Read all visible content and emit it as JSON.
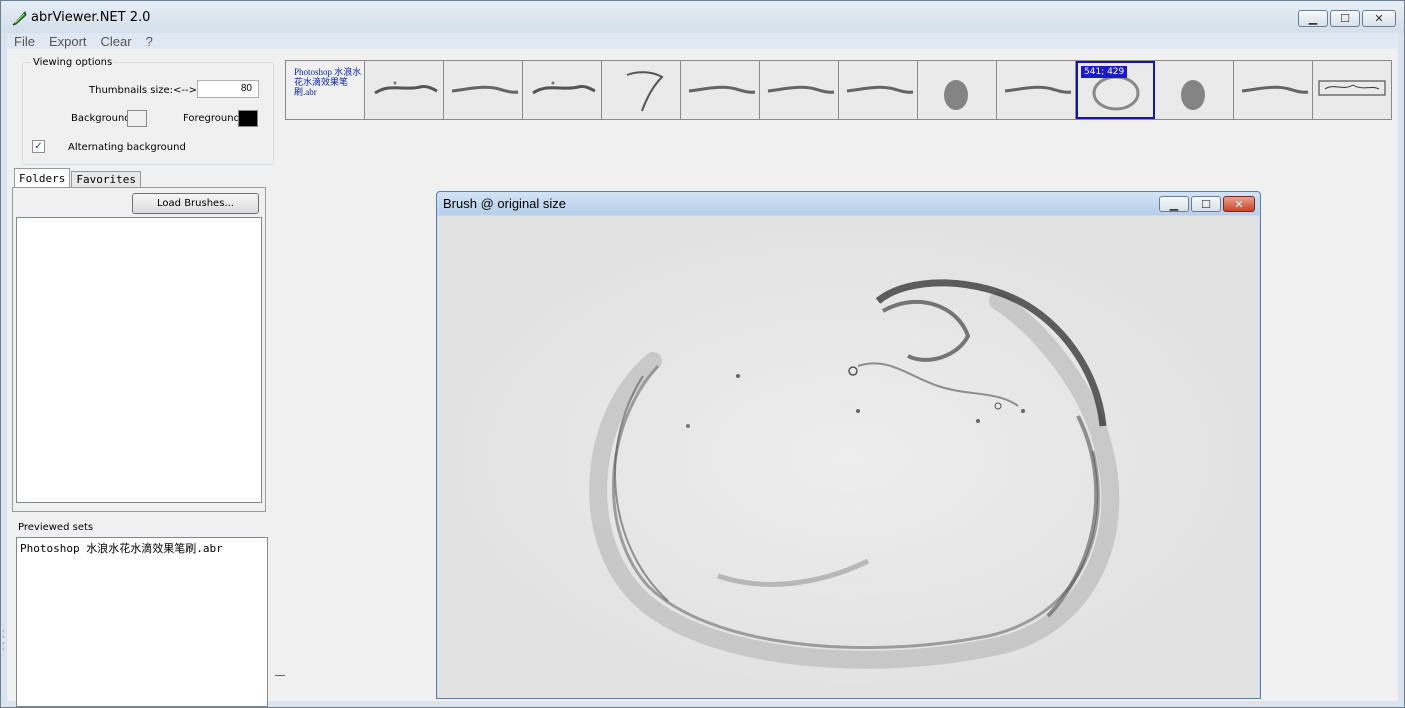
{
  "window": {
    "title": "abrViewer.NET 2.0",
    "icon": "feather-icon",
    "controls": {
      "minimize": "▁",
      "maximize": "☐",
      "close": "✕"
    }
  },
  "menu": [
    "File",
    "Export",
    "Clear",
    "?"
  ],
  "viewing_options": {
    "legend": "Viewing options",
    "thumb_size_label": "Thumbnails size:",
    "arrows": "<-->",
    "thumb_size_value": "80",
    "background_label": "Background:",
    "background_color": "#f0f0f0",
    "foreground_label": "Foreground:",
    "foreground_color": "#000000",
    "alternating_label": "Alternating background",
    "alternating_checked": true,
    "check_glyph": "✓"
  },
  "tabs": [
    "Folders",
    "Favorites"
  ],
  "load_brushes_label": "Load Brushes...",
  "previewed": {
    "label": "Previewed sets",
    "items": [
      "Photoshop 水浪水花水滴效果笔刷.abr"
    ]
  },
  "thumbnails": {
    "set_title": "Photoshop 水浪水花水滴效果笔刷.abr",
    "selected_index": 9,
    "selected_badge": "541; 429",
    "items": [
      "splash",
      "wave",
      "splash",
      "drop-splash",
      "wave",
      "wave",
      "wave",
      "drop",
      "wave",
      "ring-splash",
      "drop",
      "wave",
      "logo"
    ]
  },
  "child_window": {
    "title": "Brush @ original size",
    "controls": {
      "minimize": "▁",
      "maximize": "☐",
      "close": "✕"
    }
  }
}
